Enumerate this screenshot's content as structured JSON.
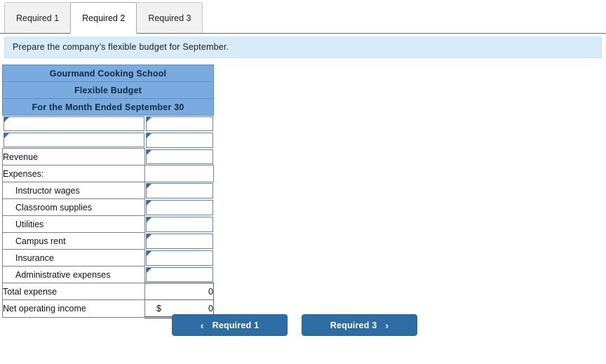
{
  "tabs": [
    {
      "label": "Required 1",
      "active": false
    },
    {
      "label": "Required 2",
      "active": true
    },
    {
      "label": "Required 3",
      "active": false
    }
  ],
  "instruction": {
    "text": "Prepare the company’s flexible budget for September."
  },
  "budget_table": {
    "titles": [
      "Gourmand Cooking School",
      "Flexible Budget",
      "For the Month Ended September 30"
    ],
    "rows": [
      {
        "label": "",
        "label_input": true,
        "value": "",
        "value_input": true
      },
      {
        "label": "",
        "label_input": true,
        "value": "",
        "value_input": true
      },
      {
        "label": "Revenue",
        "label_input": false,
        "value": "",
        "value_input": true
      },
      {
        "label": "Expenses:",
        "label_input": false,
        "value": "",
        "value_input": false
      },
      {
        "label": "Instructor wages",
        "label_input": false,
        "indent": true,
        "value": "",
        "value_input": true
      },
      {
        "label": "Classroom supplies",
        "label_input": false,
        "indent": true,
        "value": "",
        "value_input": true
      },
      {
        "label": "Utilities",
        "label_input": false,
        "indent": true,
        "value": "",
        "value_input": true
      },
      {
        "label": "Campus rent",
        "label_input": false,
        "indent": true,
        "value": "",
        "value_input": true
      },
      {
        "label": "Insurance",
        "label_input": false,
        "indent": true,
        "value": "",
        "value_input": true
      },
      {
        "label": "Administrative expenses",
        "label_input": false,
        "indent": true,
        "value": "",
        "value_input": true
      },
      {
        "label": "Total expense",
        "label_input": false,
        "value": "0",
        "value_input": false,
        "total": true
      },
      {
        "label": "Net operating income",
        "label_input": false,
        "value": "0",
        "currency": "$",
        "value_input": false,
        "grand": true
      }
    ]
  },
  "navigation": {
    "prev_label": "Required 1",
    "prev_icon": "chevron-left-icon",
    "prev_chevron": "‹",
    "next_label": "Required 3",
    "next_icon": "chevron-right-icon",
    "next_chevron": "›"
  },
  "colors": {
    "button_blue": "#2e6da4",
    "table_header_blue": "#7aabe0",
    "instruction_blue": "#d8ebf8",
    "input_border_blue": "#5a86b3"
  }
}
